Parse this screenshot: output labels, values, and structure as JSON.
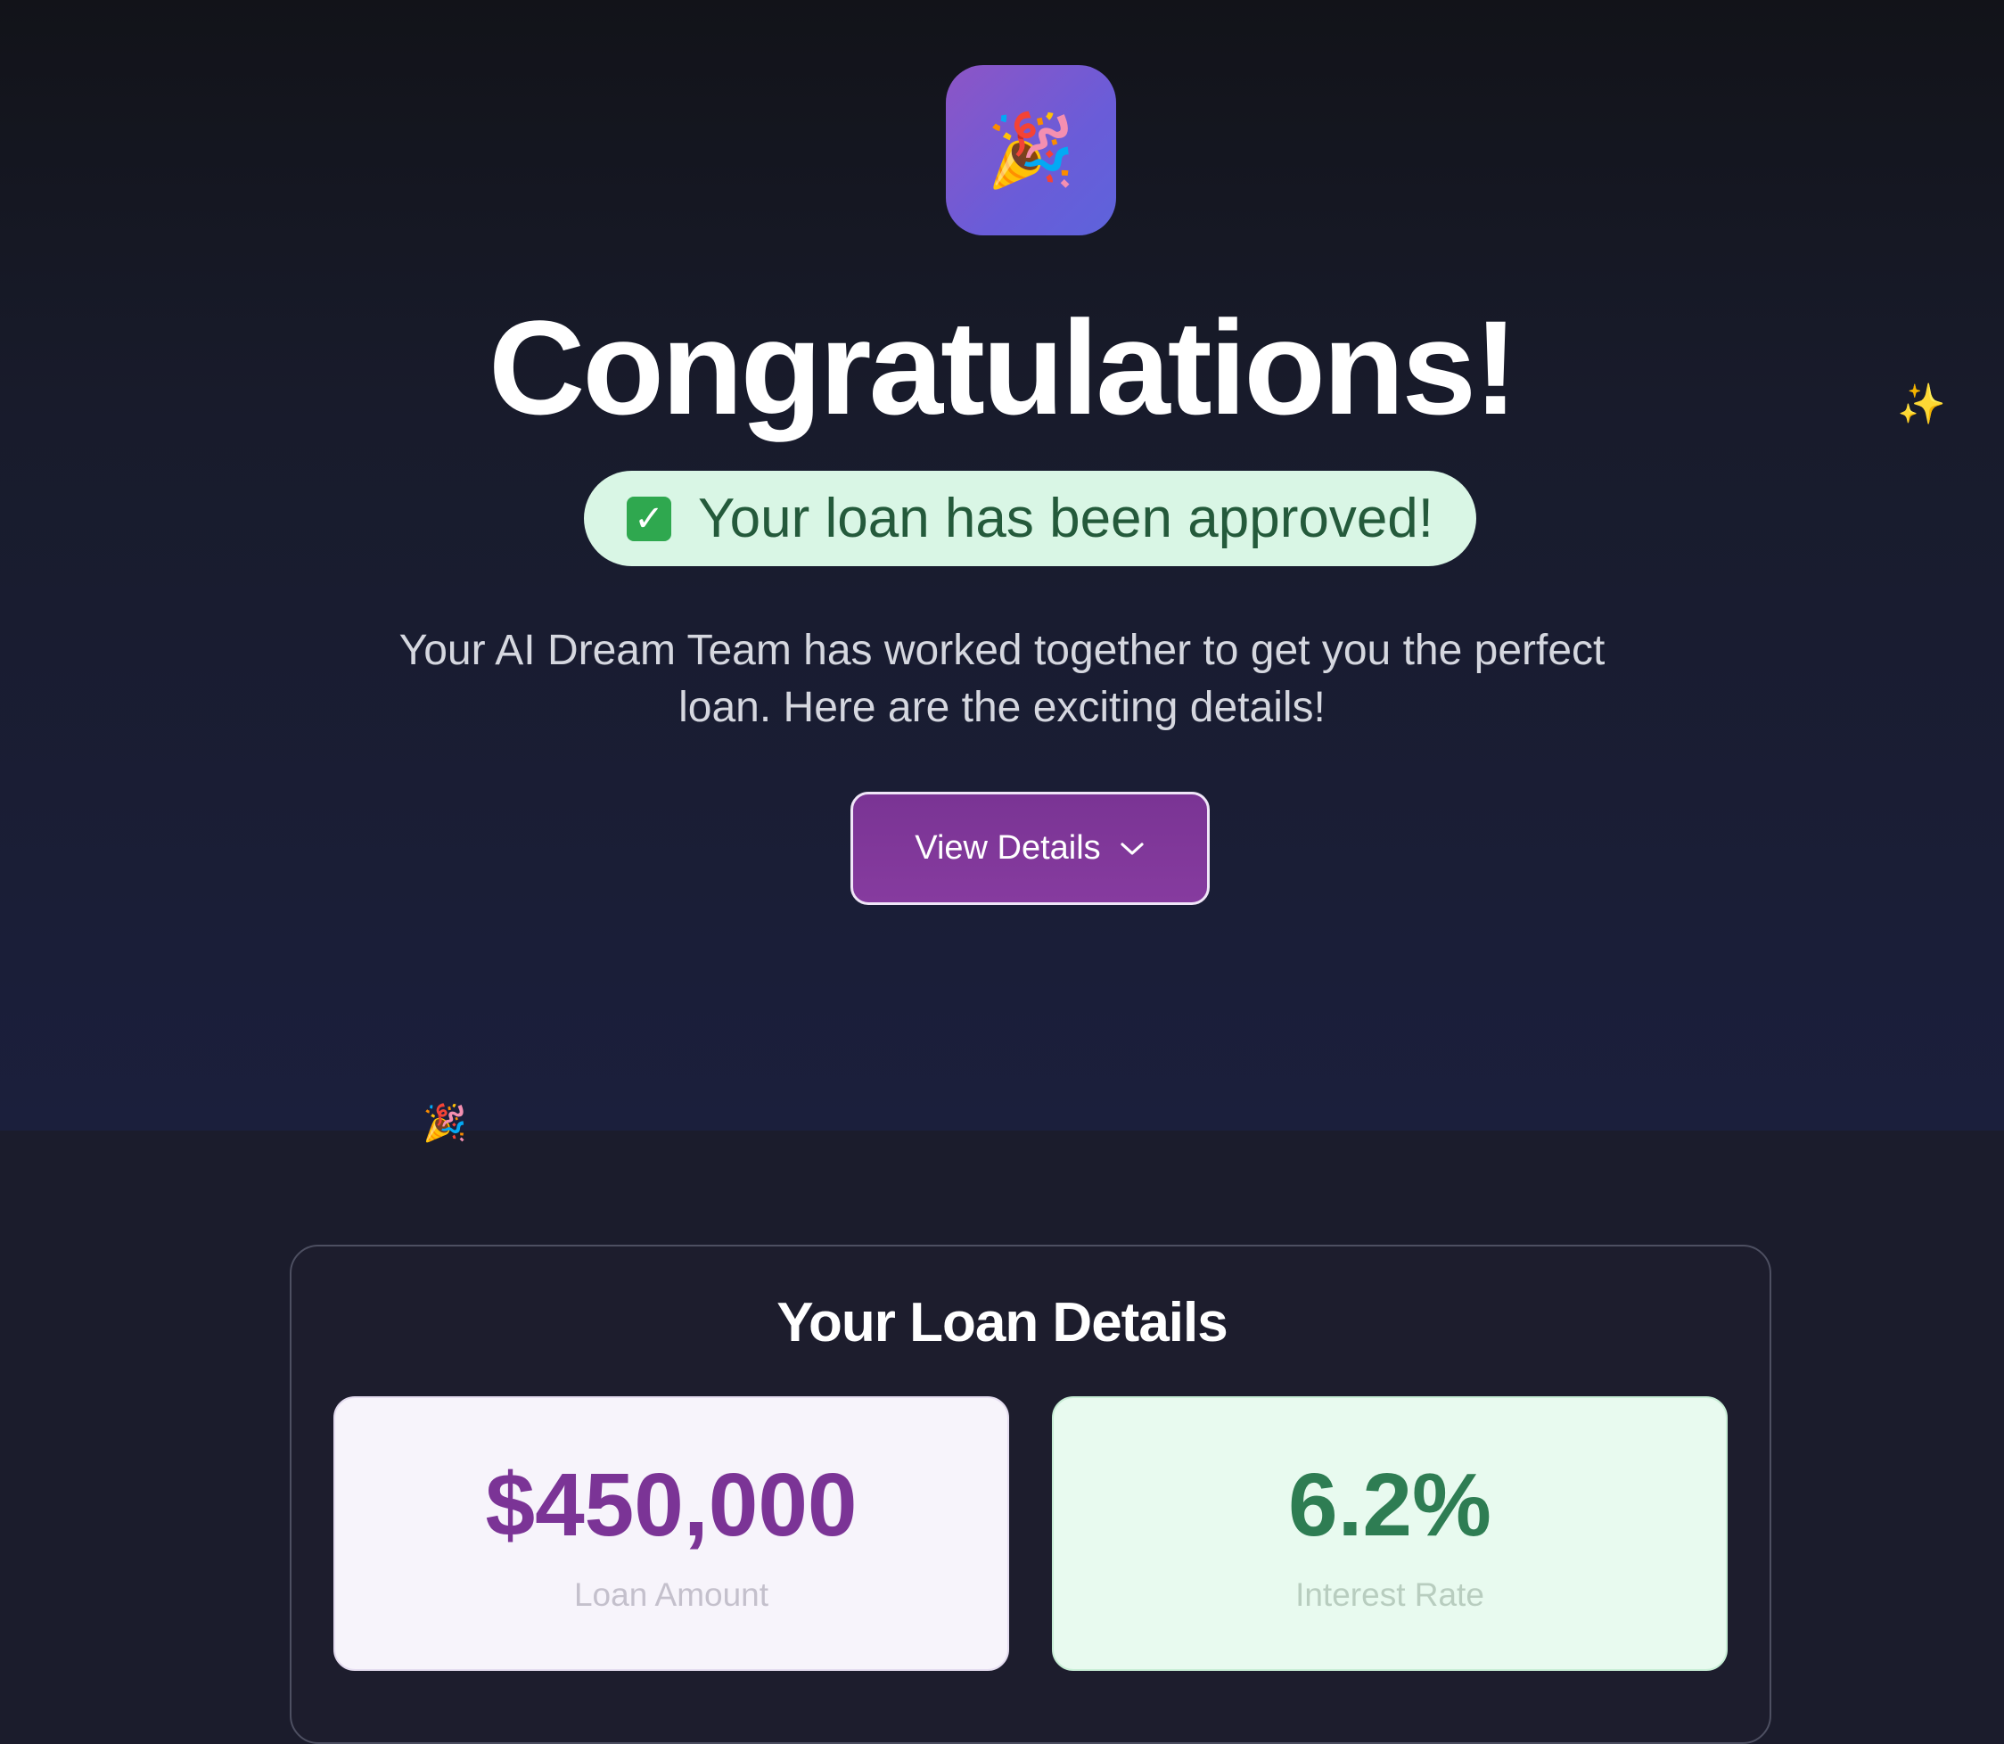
{
  "hero": {
    "icon": "party-popper-icon",
    "icon_glyph": "🎉",
    "title": "Congratulations!",
    "sparkle_icon": "sparkles-icon",
    "sparkle_glyph": "✨",
    "approved": {
      "check_icon": "check-mark-icon",
      "check_glyph": "✓",
      "text": "Your loan has been approved!"
    },
    "subtitle": "Your AI Dream Team has worked together to get you the perfect loan. Here are the exciting details!",
    "view_details_label": "View Details",
    "confetti_glyph": "🎉"
  },
  "loan_details": {
    "title": "Your Loan Details",
    "stats": [
      {
        "value": "$450,000",
        "label": "Loan Amount"
      },
      {
        "value": "6.2%",
        "label": "Interest Rate"
      }
    ]
  },
  "colors": {
    "accent_purple": "#7b3496",
    "accent_green": "#2e7d53",
    "approved_bg": "#d9f6e5",
    "page_bg": "#1b1c2c"
  }
}
